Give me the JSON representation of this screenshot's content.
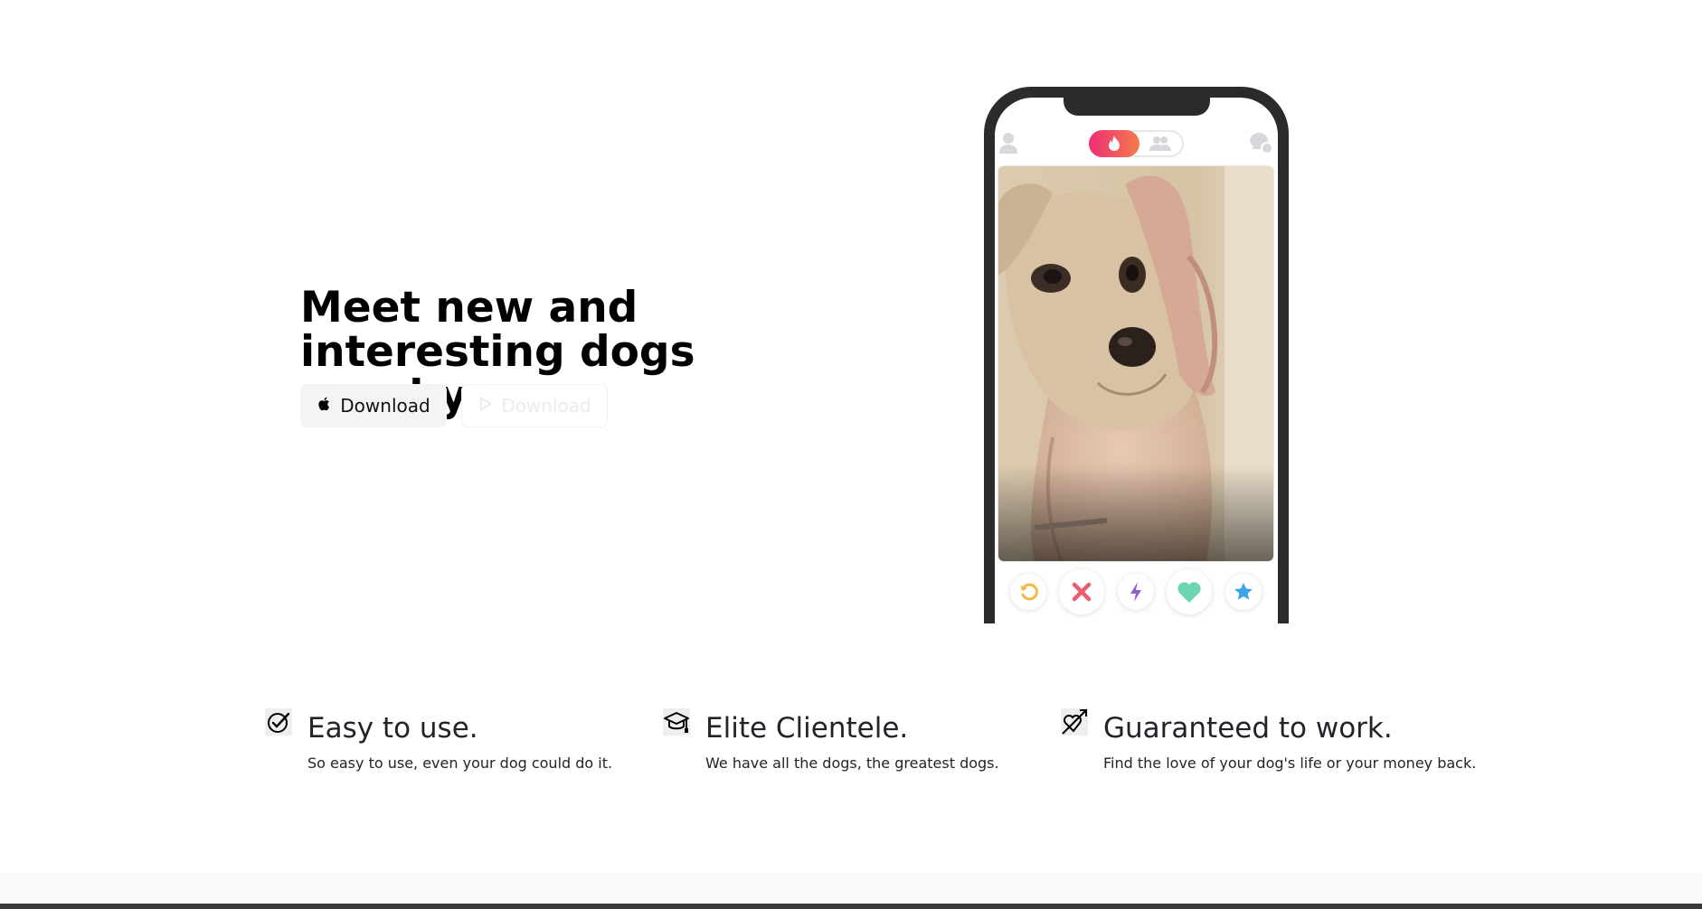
{
  "hero": {
    "title": "Meet new and interesting dogs nearby.",
    "apple_download_label": "Download",
    "play_download_label": "Download"
  },
  "phone": {
    "toggle_active": "flame-icon",
    "toggle_inactive": "group-icon",
    "actions": [
      "rewind-icon",
      "nope-icon",
      "boost-icon",
      "like-icon",
      "superlike-icon"
    ],
    "colors": {
      "rewind": "#f5b748",
      "nope": "#ec5e6f",
      "boost": "#915dd1",
      "like": "#6bd6b1",
      "superlike": "#3ca4e8",
      "toggle_start": "#ee2f77",
      "toggle_end": "#f47a4a"
    }
  },
  "features": [
    {
      "icon": "check-circle-icon",
      "title": "Easy to use.",
      "description": "So easy to use, even your dog could do it."
    },
    {
      "icon": "graduation-cap-icon",
      "title": "Elite Clientele.",
      "description": "We have all the dogs, the greatest dogs."
    },
    {
      "icon": "heart-arrow-icon",
      "title": "Guaranteed to work.",
      "description": "Find the love of your dog's life or your money back."
    }
  ]
}
